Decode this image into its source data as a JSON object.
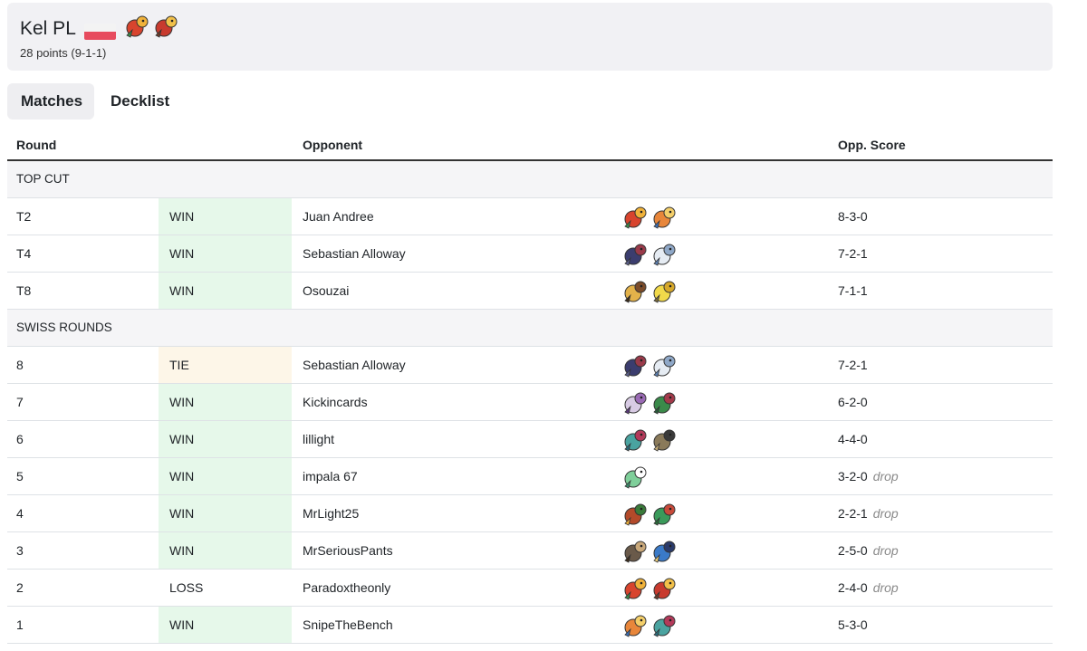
{
  "player": {
    "name": "Kel PL",
    "record": "28 points (9-1-1)",
    "flag": "poland-flag",
    "deck_icons": [
      "ho-oh-icon",
      "armarouge-icon"
    ]
  },
  "tabs": [
    "Matches",
    "Decklist"
  ],
  "columns": {
    "round": "Round",
    "opponent": "Opponent",
    "opp_score": "Opp. Score"
  },
  "sections": [
    {
      "label": "TOP CUT",
      "rows": [
        {
          "round": "T2",
          "result": "WIN",
          "opponent": "Juan Andree",
          "score": "8-3-0",
          "drop": "",
          "deck": [
            "ho-oh-icon",
            "charizard-icon"
          ]
        },
        {
          "round": "T4",
          "result": "WIN",
          "opponent": "Sebastian Alloway",
          "score": "7-2-1",
          "drop": "",
          "deck": [
            "zoroark-icon",
            "cetitan-icon"
          ]
        },
        {
          "round": "T8",
          "result": "WIN",
          "opponent": "Osouzai",
          "score": "7-1-1",
          "drop": "",
          "deck": [
            "girafarig-icon",
            "joltik-icon"
          ]
        }
      ]
    },
    {
      "label": "SWISS ROUNDS",
      "rows": [
        {
          "round": "8",
          "result": "TIE",
          "opponent": "Sebastian Alloway",
          "score": "7-2-1",
          "drop": "",
          "deck": [
            "zoroark-icon",
            "cetitan-icon"
          ]
        },
        {
          "round": "7",
          "result": "WIN",
          "opponent": "Kickincards",
          "score": "6-2-0",
          "drop": "",
          "deck": [
            "mewtwo-icon",
            "ogerpon-icon"
          ]
        },
        {
          "round": "6",
          "result": "WIN",
          "opponent": "lillight",
          "score": "4-4-0",
          "drop": "",
          "deck": [
            "dragapult-icon",
            "dusknoir-icon"
          ]
        },
        {
          "round": "5",
          "result": "WIN",
          "opponent": "impala 67",
          "score": "3-2-0",
          "drop": "drop",
          "deck": [
            "gardevoir-icon"
          ]
        },
        {
          "round": "4",
          "result": "WIN",
          "opponent": "MrLight25",
          "score": "2-2-1",
          "drop": "drop",
          "deck": [
            "ogerpon-hearthflame-icon",
            "ogerpon-teal-icon"
          ]
        },
        {
          "round": "3",
          "result": "WIN",
          "opponent": "MrSeriousPants",
          "score": "2-5-0",
          "drop": "drop",
          "deck": [
            "lokix-icon",
            "lucario-icon"
          ]
        },
        {
          "round": "2",
          "result": "LOSS",
          "opponent": "Paradoxtheonly",
          "score": "2-4-0",
          "drop": "drop",
          "deck": [
            "ho-oh-icon",
            "armarouge-icon"
          ]
        },
        {
          "round": "1",
          "result": "WIN",
          "opponent": "SnipeTheBench",
          "score": "5-3-0",
          "drop": "",
          "deck": [
            "charizard-icon",
            "dragapult-icon"
          ]
        }
      ]
    }
  ],
  "colors": {
    "win_bg": "#e6f8ea",
    "tie_bg": "#fdf6e8",
    "header_bg": "#f1f1f4",
    "flag_white": "#f3f3f3",
    "flag_red": "#e74b5e"
  }
}
